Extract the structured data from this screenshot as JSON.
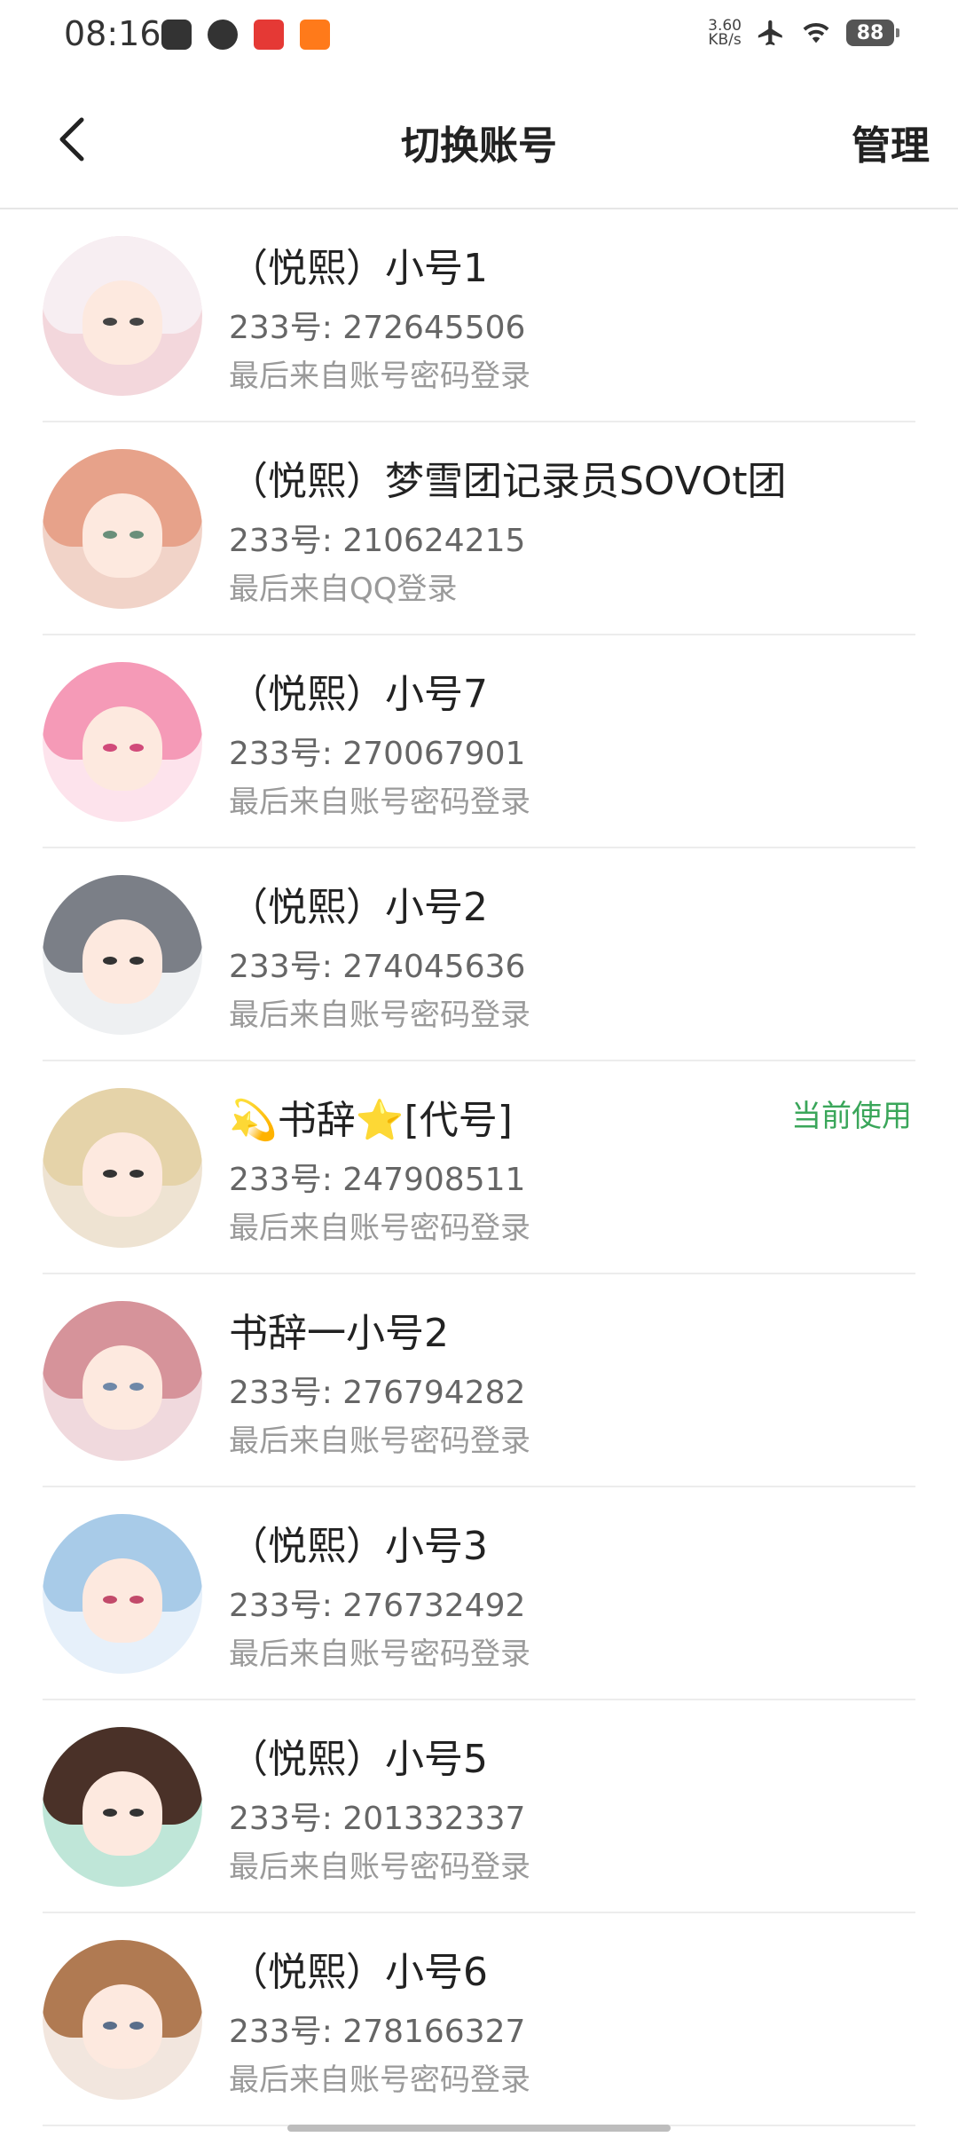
{
  "status_bar": {
    "time": "08:16",
    "net_speed_value": "3.60",
    "net_speed_unit": "KB/s",
    "battery": "88"
  },
  "header": {
    "title": "切换账号",
    "manage_label": "管理"
  },
  "accounts": [
    {
      "name": "（悦熙）小号1",
      "id": "233号: 272645506",
      "login": "最后来自账号密码登录",
      "current": "",
      "avatar": {
        "bg": "#f3d7dc",
        "hair": "#f7eef2",
        "eye": "#444444"
      }
    },
    {
      "name": "（悦熙）梦雪团记录员SOⅤOt团",
      "id": "233号: 210624215",
      "login": "最后来自QQ登录",
      "current": "",
      "avatar": {
        "bg": "#f1d3c8",
        "hair": "#e7a28a",
        "eye": "#6a8f7a"
      }
    },
    {
      "name": "（悦熙）小号7",
      "id": "233号: 270067901",
      "login": "最后来自账号密码登录",
      "current": "",
      "avatar": {
        "bg": "#fde3ec",
        "hair": "#f59ab7",
        "eye": "#d14a7a"
      }
    },
    {
      "name": "（悦熙）小号2",
      "id": "233号: 274045636",
      "login": "最后来自账号密码登录",
      "current": "",
      "avatar": {
        "bg": "#eef0f2",
        "hair": "#7b7f87",
        "eye": "#333333"
      }
    },
    {
      "name": "💫书辞⭐[代号]",
      "id": "233号: 247908511",
      "login": "最后来自账号密码登录",
      "current": "当前使用",
      "avatar": {
        "bg": "#eee3d2",
        "hair": "#e5d3a9",
        "eye": "#333333"
      }
    },
    {
      "name": "书辞一小号2",
      "id": "233号: 276794282",
      "login": "最后来自账号密码登录",
      "current": "",
      "avatar": {
        "bg": "#f0d9dd",
        "hair": "#d6939a",
        "eye": "#6f88a8"
      }
    },
    {
      "name": "（悦熙）小号3",
      "id": "233号: 276732492",
      "login": "最后来自账号密码登录",
      "current": "",
      "avatar": {
        "bg": "#e6f0fa",
        "hair": "#a8cbe8",
        "eye": "#c24a6a"
      }
    },
    {
      "name": "（悦熙）小号5",
      "id": "233号: 201332337",
      "login": "最后来自账号密码登录",
      "current": "",
      "avatar": {
        "bg": "#bfe6d8",
        "hair": "#4a3128",
        "eye": "#333333"
      }
    },
    {
      "name": "（悦熙）小号6",
      "id": "233号: 278166327",
      "login": "最后来自账号密码登录",
      "current": "",
      "avatar": {
        "bg": "#f2e6de",
        "hair": "#b07a52",
        "eye": "#5a6e8a"
      }
    }
  ]
}
